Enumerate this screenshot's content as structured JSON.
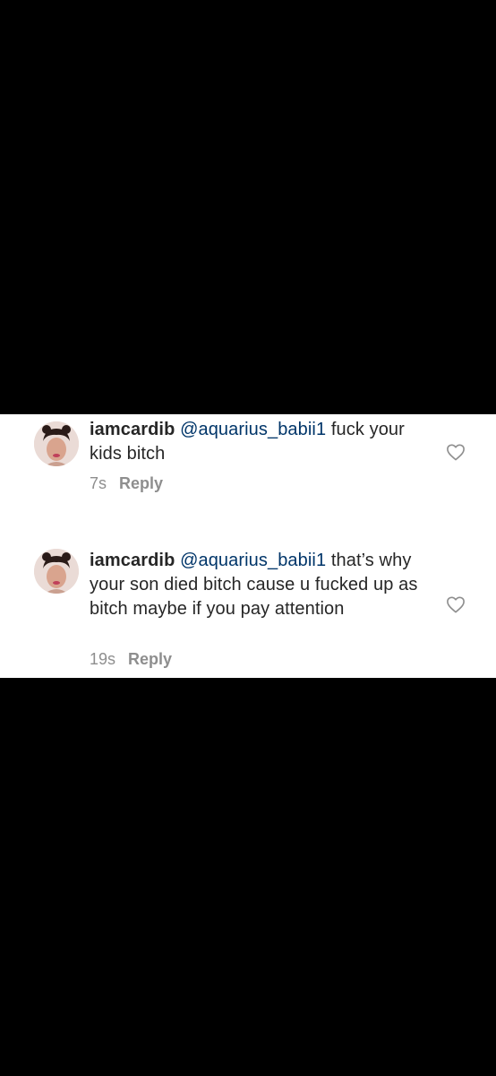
{
  "comments": [
    {
      "username": "iamcardib",
      "mention": "@aquarius_babii1",
      "text": "fuck your kids bitch",
      "time": "7s",
      "reply_label": "Reply",
      "icons": {
        "avatar": "profile-photo",
        "like": "heart-outline-icon"
      }
    },
    {
      "username": "iamcardib",
      "mention": "@aquarius_babii1",
      "text": "that’s why your son died bitch cause u fucked up as bitch maybe if you pay attention",
      "time": "19s",
      "reply_label": "Reply",
      "icons": {
        "avatar": "profile-photo",
        "like": "heart-outline-icon"
      }
    }
  ],
  "colors": {
    "background": "#000000",
    "panel": "#ffffff",
    "text": "#262626",
    "mention": "#003569",
    "meta": "#8e8e8e"
  }
}
